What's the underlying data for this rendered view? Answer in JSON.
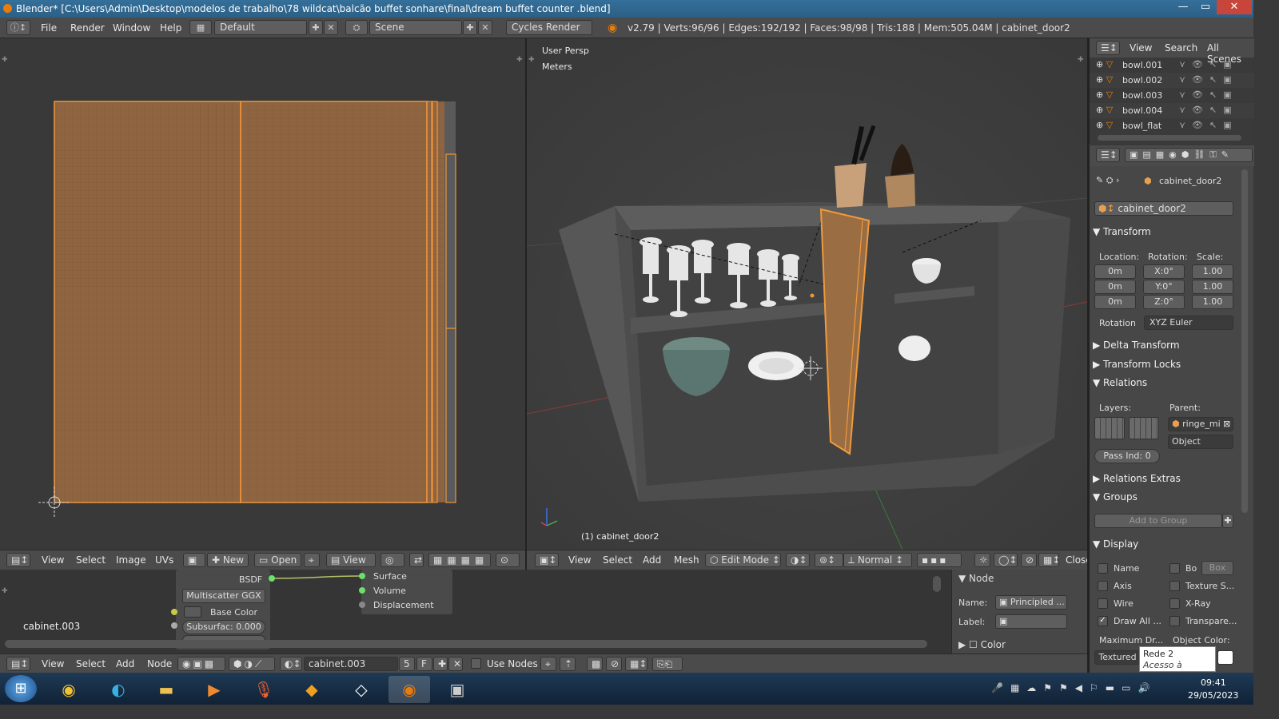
{
  "window": {
    "title": "Blender* [C:\\Users\\Admin\\Desktop\\modelos de trabalho\\78 wildcat\\balcão buffet sonhare\\final\\dream buffet counter .blend]",
    "min": "—",
    "max": "▭",
    "close": "✕"
  },
  "info_bar": {
    "menus": [
      "File",
      "Render",
      "Window",
      "Help"
    ],
    "layout": "Default",
    "scene": "Scene",
    "engine": "Cycles Render",
    "stats": "v2.79 | Verts:96/96 | Edges:192/192 | Faces:98/98 | Tris:188 | Mem:505.04M | cabinet_door2"
  },
  "uv_editor": {
    "menus": [
      "View",
      "Select",
      "Image",
      "UVs"
    ],
    "new_label": "New",
    "open_label": "Open",
    "view_label": "View"
  },
  "viewport": {
    "persp": "User Persp",
    "units": "Meters",
    "object_label": "(1) cabinet_door2",
    "menus": [
      "View",
      "Select",
      "Add",
      "Mesh"
    ],
    "mode": "Edit Mode",
    "pivot": "Normal",
    "close_label": "Close"
  },
  "node_editor": {
    "material_label": "cabinet.003",
    "node_title": "BSDF",
    "distribution": "Multiscatter GGX",
    "base_color": "Base Color",
    "subsurface": "Subsurfac: 0.000",
    "outputs": [
      "Surface",
      "Volume",
      "Displacement"
    ],
    "menus": [
      "View",
      "Select",
      "Add",
      "Node"
    ],
    "material_field": "cabinet.003",
    "user_count": "5",
    "fake_user": "F",
    "use_nodes": "Use Nodes"
  },
  "node_panel": {
    "header": "Node",
    "name_label": "Name:",
    "name_value": "Principled ...",
    "label_label": "Label:",
    "label_value": "",
    "color_label": "Color"
  },
  "outliner": {
    "tabs": [
      "View",
      "Search",
      "All Scenes"
    ],
    "items": [
      "bowl.001",
      "bowl.002",
      "bowl.003",
      "bowl.004",
      "bowl_flat"
    ]
  },
  "properties": {
    "object_path": "cabinet_door2",
    "object_name": "cabinet_door2",
    "transform": {
      "header": "Transform",
      "loc_label": "Location:",
      "rot_label": "Rotation:",
      "scale_label": "Scale:",
      "location": [
        "0m",
        "0m",
        "0m"
      ],
      "rotation": [
        "X:0°",
        "Y:0°",
        "Z:0°"
      ],
      "scale": [
        "1.00",
        "1.00",
        "1.00"
      ],
      "rotation_mode_label": "Rotation",
      "rotation_mode": "XYZ Euler"
    },
    "delta_transform": "Delta Transform",
    "transform_locks": "Transform Locks",
    "relations": {
      "header": "Relations",
      "layers_label": "Layers:",
      "parent_label": "Parent:",
      "parent_value": "ringe_mi",
      "parent_type": "Object",
      "pass_index": "Pass Ind: 0"
    },
    "relations_extras": "Relations Extras",
    "groups": {
      "header": "Groups",
      "add_label": "Add to Group"
    },
    "display": {
      "header": "Display",
      "name": "Name",
      "bounds": "Bo",
      "bounds_type": "Box",
      "axis": "Axis",
      "texture_space": "Texture S...",
      "wire": "Wire",
      "xray": "X-Ray",
      "draw_all": "Draw All ...",
      "transparent": "Transpare...",
      "max_draw_label": "Maximum Dr...",
      "object_color_label": "Object Color:",
      "max_draw_value": "Textured"
    }
  },
  "tooltip": {
    "line1": "Rede  2",
    "line2": "Acesso à Internet"
  },
  "taskbar": {
    "time": "09:41",
    "date": "29/05/2023"
  },
  "colors": {
    "accent": "#e87d0d",
    "door": "#9a6d43",
    "select": "#f09a3c"
  }
}
